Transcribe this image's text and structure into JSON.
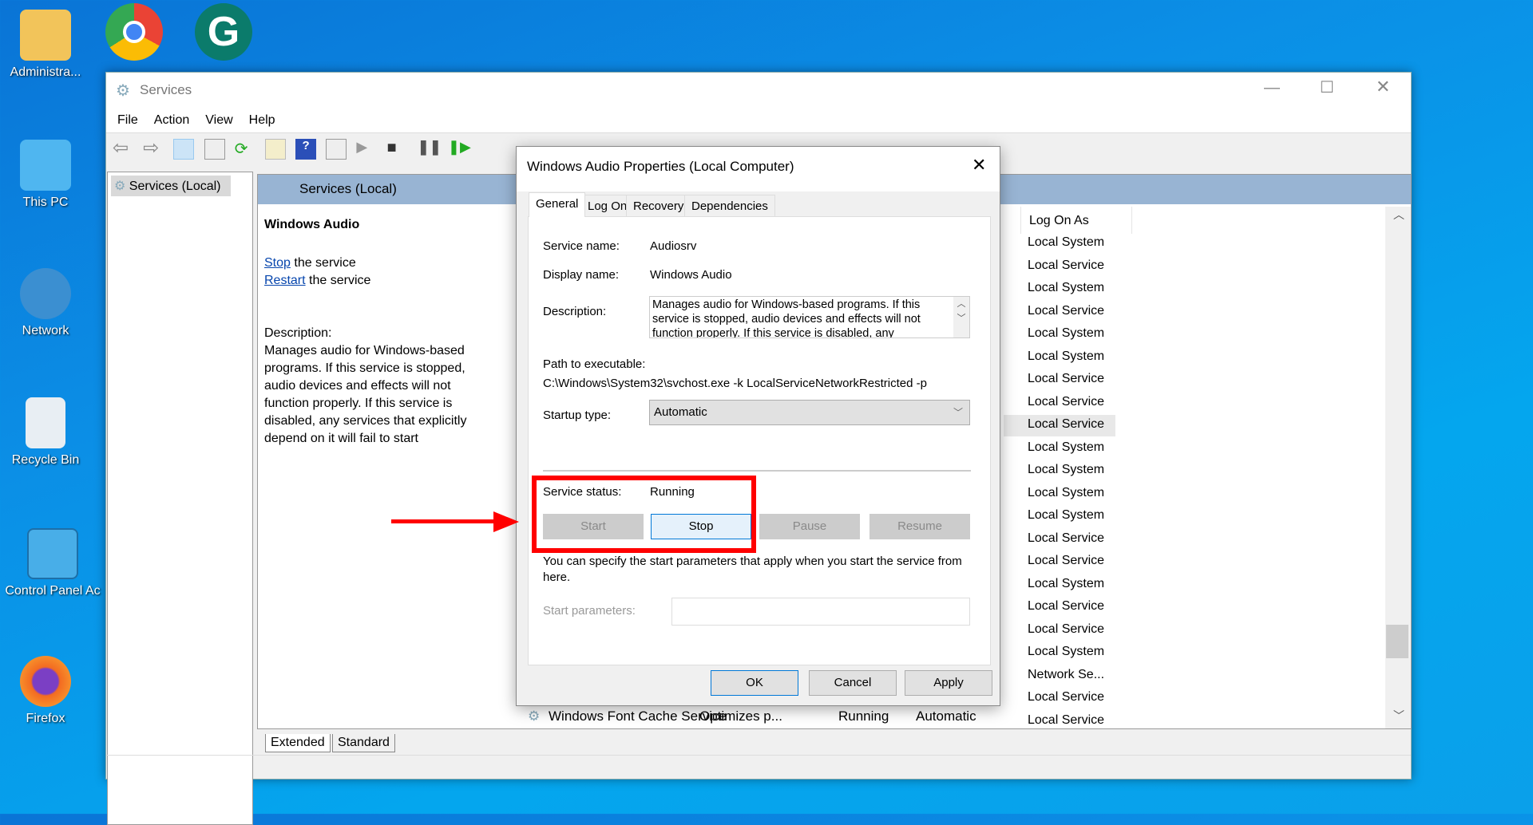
{
  "desktop": {
    "icons": [
      {
        "label": "Administra...",
        "name": "administrator-folder",
        "color": "#f2c45a"
      },
      {
        "label": "This PC",
        "name": "this-pc",
        "color": "#4fb6f0"
      },
      {
        "label": "Network",
        "name": "network",
        "color": "#3b8fd1"
      },
      {
        "label": "Recycle Bin",
        "name": "recycle-bin",
        "color": "#e8eef3"
      },
      {
        "label": "Control Panel Ac",
        "name": "control-panel",
        "color": "#48aee8"
      },
      {
        "label": "Firefox",
        "name": "firefox",
        "color": "#f36b21"
      }
    ]
  },
  "window": {
    "title": "Services",
    "menu": [
      "File",
      "Action",
      "View",
      "Help"
    ],
    "tree_item": "Services (Local)",
    "pane_header": "Services (Local)",
    "selected_service": "Windows Audio",
    "stop_link": "Stop",
    "restart_link": "Restart",
    "link_suffix": " the service",
    "description_label": "Description:",
    "description": "Manages audio for Windows-based programs.  If this service is stopped, audio devices and effects will not function properly.  If this service is disabled, any services that explicitly depend on it will fail to start",
    "column_logon": "Log On As",
    "logon_values": [
      "Local System",
      "Local Service",
      "Local System",
      "Local Service",
      "Local System",
      "Local System",
      "Local Service",
      "Local Service",
      "Local Service",
      "Local System",
      "Local System",
      "Local System",
      "Local System",
      "Local Service",
      "Local Service",
      "Local System",
      "Local Service",
      "Local Service",
      "Local System",
      "Network Se...",
      "Local Service",
      "Local Service"
    ],
    "selected_row_index": 8,
    "last_row": {
      "name": "Windows Font Cache Service",
      "description": "Optimizes p...",
      "status": "Running",
      "startup": "Automatic"
    },
    "view_tabs": [
      "Extended",
      "Standard"
    ]
  },
  "dialog": {
    "title": "Windows Audio Properties (Local Computer)",
    "tabs": [
      "General",
      "Log On",
      "Recovery",
      "Dependencies"
    ],
    "service_name_label": "Service name:",
    "service_name": "Audiosrv",
    "display_name_label": "Display name:",
    "display_name": "Windows Audio",
    "description_label": "Description:",
    "description": "Manages audio for Windows-based programs.  If this service is stopped, audio devices and effects will not function properly.  If this service is disabled, any",
    "path_label": "Path to executable:",
    "path": "C:\\Windows\\System32\\svchost.exe -k LocalServiceNetworkRestricted -p",
    "startup_label": "Startup type:",
    "startup_value": "Automatic",
    "status_label": "Service status:",
    "status_value": "Running",
    "buttons": {
      "start": "Start",
      "stop": "Stop",
      "pause": "Pause",
      "resume": "Resume"
    },
    "help_text": "You can specify the start parameters that apply when you start the service from here.",
    "params_label": "Start parameters:",
    "params_value": "",
    "ok": "OK",
    "cancel": "Cancel",
    "apply": "Apply"
  },
  "annotation_color": "#ff0000"
}
